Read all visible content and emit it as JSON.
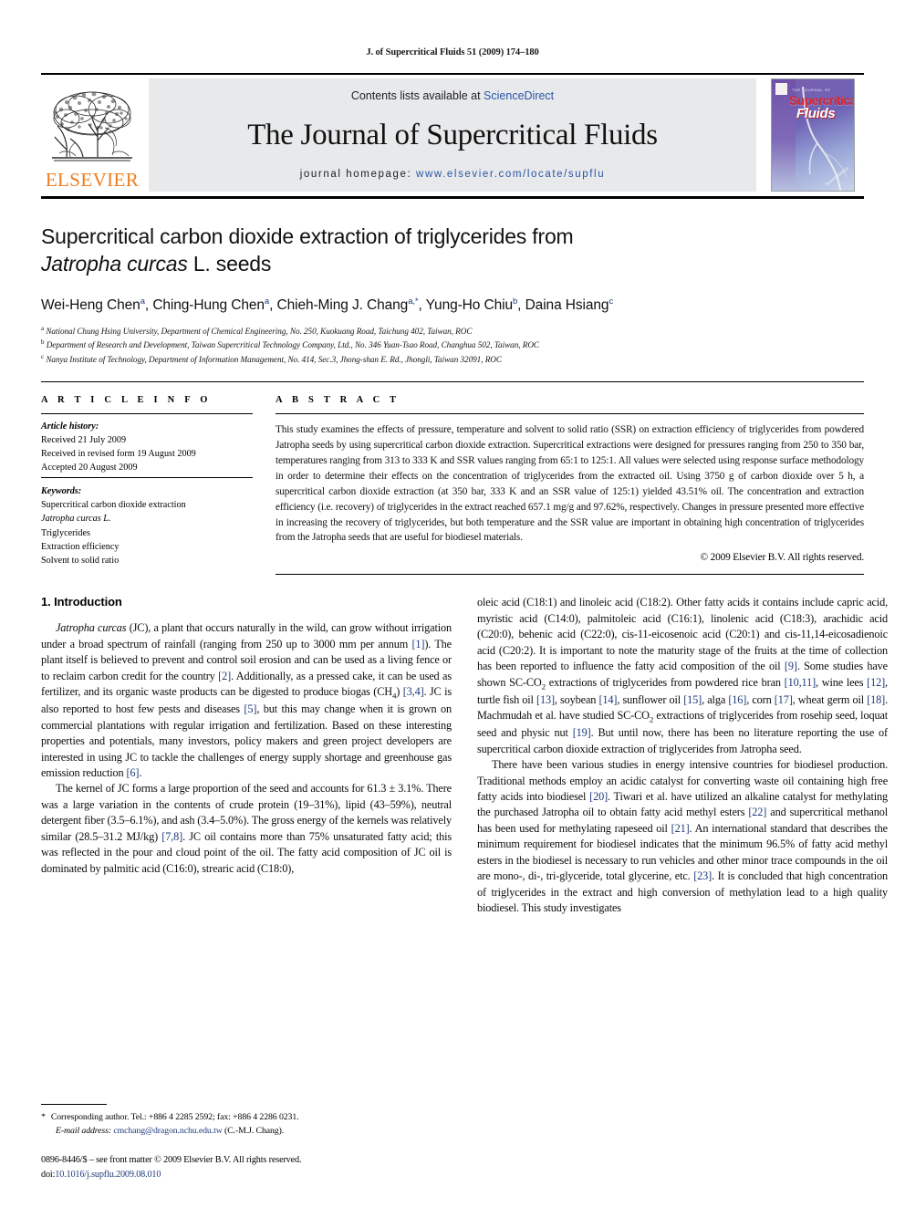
{
  "running_head": "J. of Supercritical Fluids 51 (2009) 174–180",
  "masthead": {
    "publisher": "ELSEVIER",
    "contents_prefix": "Contents lists available at ",
    "contents_link": "ScienceDirect",
    "journal_name": "The Journal of Supercritical Fluids",
    "homepage_prefix": "journal homepage:",
    "homepage_url": "www.elsevier.com/locate/supflu",
    "cover": {
      "top_text": "THE JOURNAL OF",
      "word1": "Supercritical",
      "word2": "Fluids",
      "corner_text": "ScienceDirect"
    },
    "colors": {
      "link": "#2b55a8",
      "elsevier_orange": "#f07c1c",
      "banner_bg": "#e8e9eb",
      "cover_red": "#d6262c"
    }
  },
  "title": {
    "line1": "Supercritical carbon dioxide extraction of triglycerides from",
    "line2_italic": "Jatropha curcas",
    "line2_rest": " L. seeds"
  },
  "authors": [
    {
      "name": "Wei-Heng Chen",
      "sup": "a"
    },
    {
      "name": "Ching-Hung Chen",
      "sup": "a"
    },
    {
      "name": "Chieh-Ming J. Chang",
      "sup": "a,*"
    },
    {
      "name": "Yung-Ho Chiu",
      "sup": "b"
    },
    {
      "name": "Daina Hsiang",
      "sup": "c"
    }
  ],
  "affiliations": [
    {
      "mark": "a",
      "text": "National Chung Hsing University, Department of Chemical Engineering, No. 250, Kuokuang Road, Taichung 402, Taiwan, ROC"
    },
    {
      "mark": "b",
      "text": "Department of Research and Development, Taiwan Supercritical Technology Company, Ltd., No. 346 Yuan-Tsao Road, Changhua 502, Taiwan, ROC"
    },
    {
      "mark": "c",
      "text": "Nanya Institute of Technology, Department of Information Management, No. 414, Sec.3, Jhong-shan E. Rd., Jhongli, Taiwan 32091, ROC"
    }
  ],
  "article_info": {
    "heading": "A R T I C L E  I N F O",
    "history_label": "Article history:",
    "history": [
      "Received 21 July 2009",
      "Received in revised form 19 August 2009",
      "Accepted 20 August 2009"
    ],
    "keywords_label": "Keywords:",
    "keywords": [
      "Supercritical carbon dioxide extraction",
      "Jatropha curcas L.",
      "Triglycerides",
      "Extraction efficiency",
      "Solvent to solid ratio"
    ]
  },
  "abstract": {
    "heading": "A B S T R A C T",
    "text": "This study examines the effects of pressure, temperature and solvent to solid ratio (SSR) on extraction efficiency of triglycerides from powdered Jatropha seeds by using supercritical carbon dioxide extraction. Supercritical extractions were designed for pressures ranging from 250 to 350 bar, temperatures ranging from 313 to 333 K and SSR values ranging from 65:1 to 125:1. All values were selected using response surface methodology in order to determine their effects on the concentration of triglycerides from the extracted oil. Using 3750 g of carbon dioxide over 5 h, a supercritical carbon dioxide extraction (at 350 bar, 333 K and an SSR value of 125:1) yielded 43.51% oil. The concentration and extraction efficiency (i.e. recovery) of triglycerides in the extract reached 657.1 mg/g and 97.62%, respectively. Changes in pressure presented more effective in increasing the recovery of triglycerides, but both temperature and the SSR value are important in obtaining high concentration of triglycerides from the Jatropha seeds that are useful for biodiesel materials.",
    "copyright": "© 2009 Elsevier B.V. All rights reserved."
  },
  "introduction": {
    "section_number_title": "1. Introduction",
    "left_paragraphs": [
      "Jatropha curcas (JC), a plant that occurs naturally in the wild, can grow without irrigation under a broad spectrum of rainfall (ranging from 250 up to 3000 mm per annum [1]). The plant itself is believed to prevent and control soil erosion and can be used as a living fence or to reclaim carbon credit for the country [2]. Additionally, as a pressed cake, it can be used as fertilizer, and its organic waste products can be digested to produce biogas (CH4) [3,4]. JC is also reported to host few pests and diseases [5], but this may change when it is grown on commercial plantations with regular irrigation and fertilization. Based on these interesting properties and potentials, many investors, policy makers and green project developers are interested in using JC to tackle the challenges of energy supply shortage and greenhouse gas emission reduction [6].",
      "The kernel of JC forms a large proportion of the seed and accounts for 61.3 ± 3.1%. There was a large variation in the contents of crude protein (19–31%), lipid (43–59%), neutral detergent fiber (3.5–6.1%), and ash (3.4–5.0%). The gross energy of the kernels was relatively similar (28.5–31.2 MJ/kg) [7,8]. JC oil contains more than 75% unsaturated fatty acid; this was reflected in the pour and cloud point of the oil. The fatty acid composition of JC oil is dominated by palmitic acid (C16:0), strearic acid (C18:0),"
    ],
    "right_paragraphs": [
      "oleic acid (C18:1) and linoleic acid (C18:2). Other fatty acids it contains include capric acid, myristic acid (C14:0), palmitoleic acid (C16:1), linolenic acid (C18:3), arachidic acid (C20:0), behenic acid (C22:0), cis-11-eicosenoic acid (C20:1) and cis-11,14-eicosadienoic acid (C20:2). It is important to note the maturity stage of the fruits at the time of collection has been reported to influence the fatty acid composition of the oil [9]. Some studies have shown SC-CO2 extractions of triglycerides from powdered rice bran [10,11], wine lees [12], turtle fish oil [13], soybean [14], sunflower oil [15], alga [16], corn [17], wheat germ oil [18]. Machmudah et al. have studied SC-CO2 extractions of triglycerides from rosehip seed, loquat seed and physic nut [19]. But until now, there has been no literature reporting the use of supercritical carbon dioxide extraction of triglycerides from Jatropha seed.",
      "There have been various studies in energy intensive countries for biodiesel production. Traditional methods employ an acidic catalyst for converting waste oil containing high free fatty acids into biodiesel [20]. Tiwari et al. have utilized an alkaline catalyst for methylating the purchased Jatropha oil to obtain fatty acid methyl esters [22] and supercritical methanol has been used for methylating rapeseed oil [21]. An international standard that describes the minimum requirement for biodiesel indicates that the minimum 96.5% of fatty acid methyl esters in the biodiesel is necessary to run vehicles and other minor trace compounds in the oil are mono-, di-, tri-glyceride, total glycerine, etc. [23]. It is concluded that high concentration of triglycerides in the extract and high conversion of methylation lead to a high quality biodiesel. This study investigates"
    ]
  },
  "footnote": {
    "star": "*",
    "line1": "Corresponding author. Tel.: +886 4 2285 2592; fax: +886 4 2286 0231.",
    "email_label": "E-mail address:",
    "email": "cmchang@dragon.nchu.edu.tw",
    "email_suffix": " (C.-M.J. Chang)."
  },
  "issn_block": {
    "line1": "0896-8446/$ – see front matter © 2009 Elsevier B.V. All rights reserved.",
    "doi_prefix": "doi:",
    "doi": "10.1016/j.supflu.2009.08.010"
  }
}
